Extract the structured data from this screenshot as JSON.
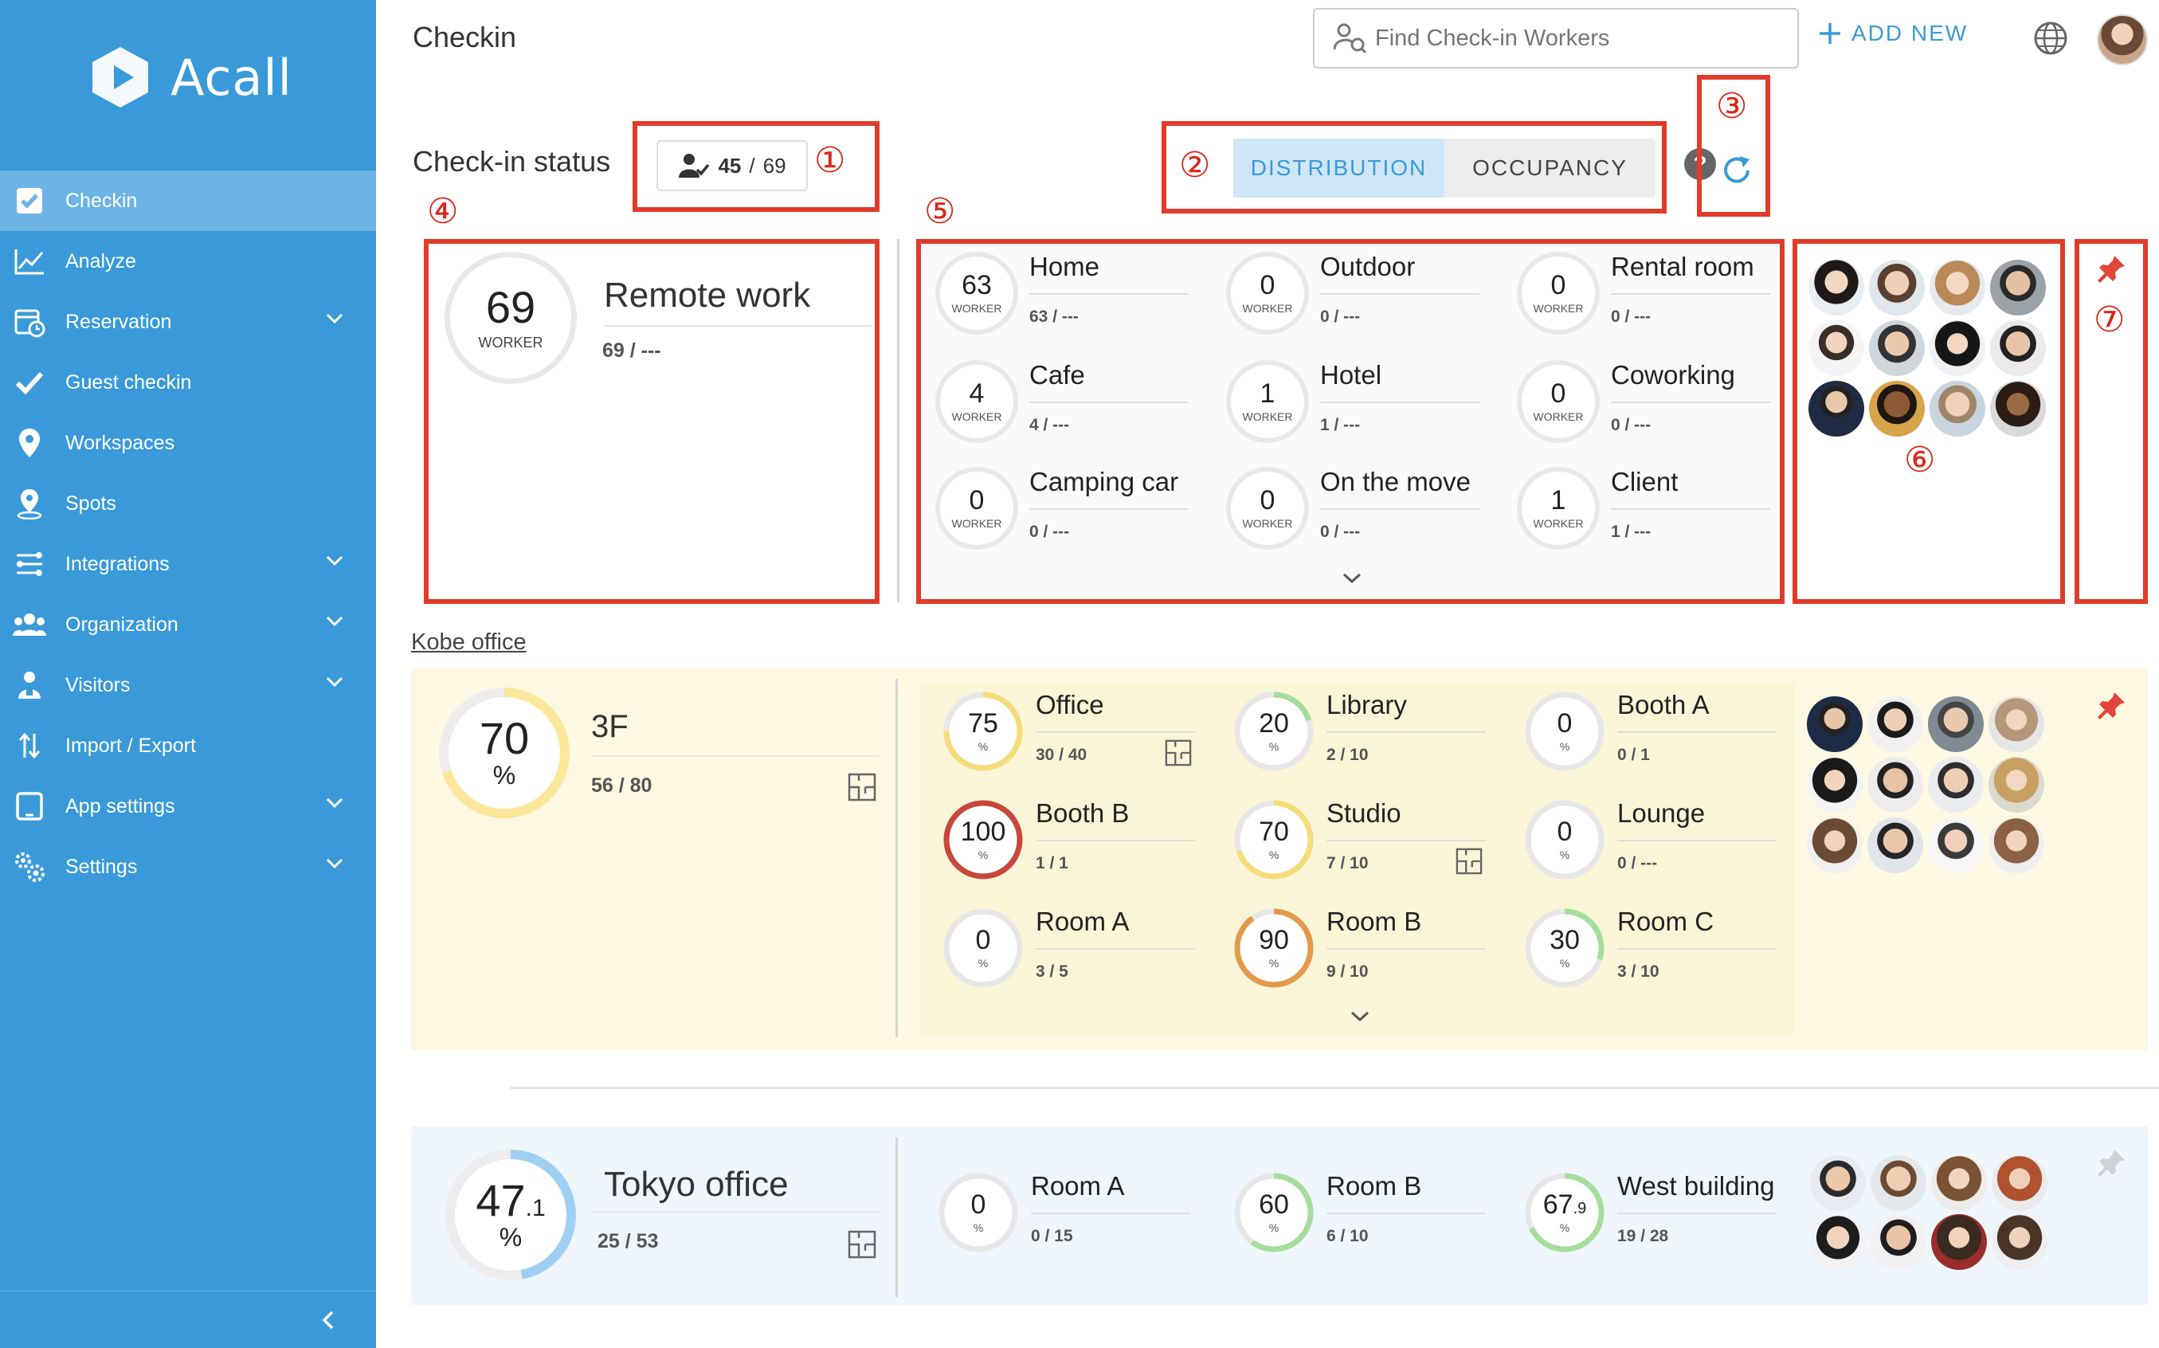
{
  "brand": {
    "name": "Acall"
  },
  "sidebar": {
    "items": [
      {
        "label": "Checkin",
        "icon": "checkbox-icon",
        "active": true,
        "expandable": false
      },
      {
        "label": "Analyze",
        "icon": "chart-line-icon",
        "expandable": false
      },
      {
        "label": "Reservation",
        "icon": "calendar-clock-icon",
        "expandable": true
      },
      {
        "label": "Guest checkin",
        "icon": "check-icon",
        "expandable": false
      },
      {
        "label": "Workspaces",
        "icon": "location-pin-icon",
        "expandable": false
      },
      {
        "label": "Spots",
        "icon": "spot-pin-icon",
        "expandable": false
      },
      {
        "label": "Integrations",
        "icon": "integrations-icon",
        "expandable": true
      },
      {
        "label": "Organization",
        "icon": "people-icon",
        "expandable": true
      },
      {
        "label": "Visitors",
        "icon": "visitor-icon",
        "expandable": true
      },
      {
        "label": "Import / Export",
        "icon": "import-export-icon",
        "expandable": false
      },
      {
        "label": "App settings",
        "icon": "tablet-icon",
        "expandable": true
      },
      {
        "label": "Settings",
        "icon": "gears-icon",
        "expandable": true
      }
    ]
  },
  "header": {
    "title": "Checkin",
    "search_placeholder": "Find Check-in Workers",
    "add_new_label": "ADD NEW"
  },
  "status": {
    "label": "Check-in status",
    "checked_in": "45",
    "separator": "/",
    "total": "69",
    "toggle": {
      "distribution": "DISTRIBUTION",
      "occupancy": "OCCUPANCY",
      "selected": "DISTRIBUTION"
    },
    "help": "?"
  },
  "markers": [
    "①",
    "②",
    "③",
    "④",
    "⑤",
    "⑥",
    "⑦"
  ],
  "remote": {
    "value": "69",
    "unit": "WORKER",
    "title": "Remote work",
    "count": "69 / ---",
    "cells": [
      {
        "value": "63",
        "unit": "WORKER",
        "name": "Home",
        "count": "63 / ---"
      },
      {
        "value": "0",
        "unit": "WORKER",
        "name": "Outdoor",
        "count": "0 / ---"
      },
      {
        "value": "0",
        "unit": "WORKER",
        "name": "Rental room",
        "count": "0 / ---"
      },
      {
        "value": "4",
        "unit": "WORKER",
        "name": "Cafe",
        "count": "4 / ---"
      },
      {
        "value": "1",
        "unit": "WORKER",
        "name": "Hotel",
        "count": "1 / ---"
      },
      {
        "value": "0",
        "unit": "WORKER",
        "name": "Coworking",
        "count": "0 / ---"
      },
      {
        "value": "0",
        "unit": "WORKER",
        "name": "Camping car",
        "count": "0 / ---"
      },
      {
        "value": "0",
        "unit": "WORKER",
        "name": "On the move",
        "count": "0 / ---"
      },
      {
        "value": "1",
        "unit": "WORKER",
        "name": "Client",
        "count": "1 / ---"
      }
    ]
  },
  "kobe": {
    "link": "Kobe office",
    "floor": {
      "value": "70",
      "unit": "%",
      "percent": 70,
      "name": "3F",
      "count": "56 / 80"
    },
    "cells": [
      {
        "value": "75",
        "unit": "%",
        "percent": 75,
        "color": "#f5dc7a",
        "name": "Office",
        "count": "30 / 40",
        "floorplan": true
      },
      {
        "value": "20",
        "unit": "%",
        "percent": 20,
        "color": "#a6dd9c",
        "name": "Library",
        "count": "2 / 10",
        "floorplan": false
      },
      {
        "value": "0",
        "unit": "%",
        "percent": 0,
        "color": "#a6dd9c",
        "name": "Booth A",
        "count": "0 / 1",
        "floorplan": false
      },
      {
        "value": "100",
        "unit": "%",
        "percent": 100,
        "color": "#c8473c",
        "name": "Booth B",
        "count": "1 / 1",
        "floorplan": false
      },
      {
        "value": "70",
        "unit": "%",
        "percent": 70,
        "color": "#f5dc7a",
        "name": "Studio",
        "count": "7 / 10",
        "floorplan": true
      },
      {
        "value": "0",
        "unit": "%",
        "percent": 0,
        "color": "#a6dd9c",
        "name": "Lounge",
        "count": "0 / ---",
        "floorplan": false
      },
      {
        "value": "0",
        "unit": "%",
        "percent": 0,
        "color": "#a6dd9c",
        "name": "Room A",
        "count": "3 / 5",
        "floorplan": false
      },
      {
        "value": "90",
        "unit": "%",
        "percent": 90,
        "color": "#e39a4b",
        "name": "Room B",
        "count": "9 / 10",
        "floorplan": false
      },
      {
        "value": "30",
        "unit": "%",
        "percent": 30,
        "color": "#a6dd9c",
        "name": "Room C",
        "count": "3 / 10",
        "floorplan": false
      }
    ]
  },
  "tokyo": {
    "value_int": "47",
    "value_dec": ".1",
    "unit": "%",
    "percent": 47.1,
    "name": "Tokyo office",
    "count": "25 / 53",
    "cells": [
      {
        "value": "0",
        "dec": "",
        "unit": "%",
        "percent": 0,
        "color": "#a6dd9c",
        "name": "Room A",
        "count": "0 / 15"
      },
      {
        "value": "60",
        "dec": "",
        "unit": "%",
        "percent": 60,
        "color": "#a6dd9c",
        "name": "Room B",
        "count": "6 / 10"
      },
      {
        "value": "67",
        "dec": ".9",
        "unit": "%",
        "percent": 67.9,
        "color": "#a6dd9c",
        "name": "West building",
        "count": "19 / 28"
      }
    ]
  },
  "colors": {
    "sidebar": "#3a9ad9",
    "sidebar_active": "#6cb3e6",
    "accent": "#3a9ad9",
    "annotation_red": "#e23b2a",
    "pin_red": "#e0463a",
    "kobe_bg": "#fdf8e1",
    "tokyo_bg": "#eef6fc",
    "tokyo_ring": "#9fd0f4",
    "floor_ring": "#fbe79a"
  }
}
